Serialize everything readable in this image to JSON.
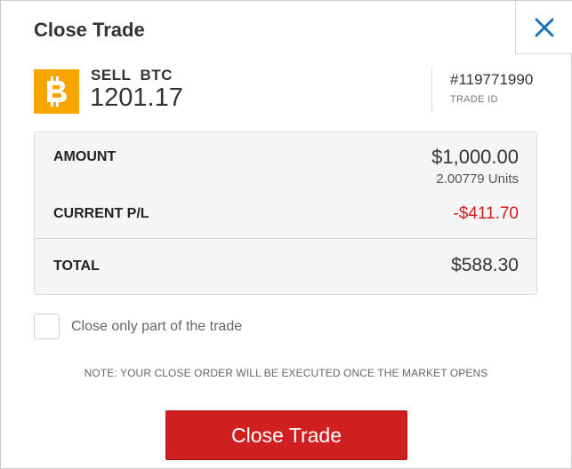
{
  "dialog": {
    "title": "Close Trade",
    "close_icon": "close-icon"
  },
  "trade": {
    "direction": "SELL",
    "symbol": "BTC",
    "rate": "1201.17",
    "id": "#119771990",
    "id_label": "TRADE ID",
    "instrument_icon": "bitcoin-icon",
    "instrument_color": "#f7a600"
  },
  "summary": {
    "amount_label": "AMOUNT",
    "amount_value": "$1,000.00",
    "units": "2.00779 Units",
    "pl_label": "CURRENT P/L",
    "pl_value": "-$411.70",
    "pl_color": "#d01f1f",
    "total_label": "TOTAL",
    "total_value": "$588.30"
  },
  "partial_close": {
    "label": "Close only part of the trade",
    "checked": false
  },
  "note": "NOTE: YOUR CLOSE ORDER WILL BE EXECUTED ONCE THE MARKET OPENS",
  "cta": {
    "label": "Close Trade",
    "color": "#d01f1f"
  },
  "accent_color": "#1a73b8"
}
